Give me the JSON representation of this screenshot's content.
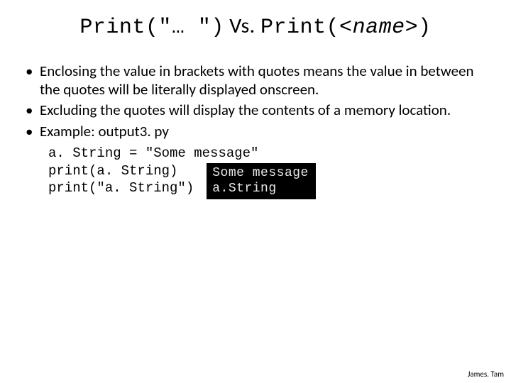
{
  "title": {
    "part1": "Print(\"… \")",
    "vs": " Vs. ",
    "part2": "Print(<",
    "name_italic": "name",
    "part3": ">)"
  },
  "bullets": [
    "Enclosing the value in brackets with quotes means the value in between the quotes will be literally displayed onscreen.",
    "Excluding the quotes will display the contents of a memory location.",
    "Example: output3. py"
  ],
  "code": {
    "line1": "a. String = \"Some message\"",
    "line2": "print(a. String)",
    "line3": "print(\"a. String\")"
  },
  "terminal": {
    "line1": "Some message",
    "line2": "a.String"
  },
  "footer": "James. Tam"
}
